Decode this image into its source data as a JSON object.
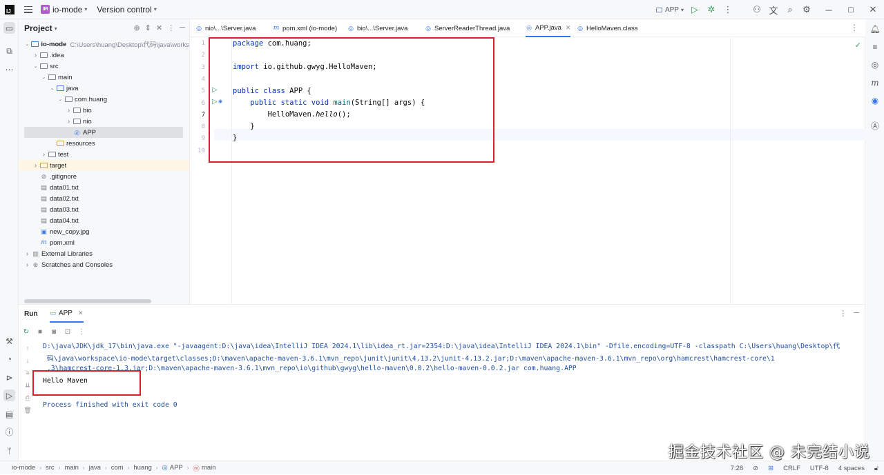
{
  "titlebar": {
    "project_badge": "IM",
    "project_name": "io-mode",
    "vcs_label": "Version control",
    "run_config": "APP"
  },
  "project_panel": {
    "title": "Project",
    "tree": [
      {
        "label": "io-mode",
        "hint": "C:\\Users\\huang\\Desktop\\代码\\java\\works",
        "depth": 0,
        "icon": "module-folder-icon",
        "expand": "open"
      },
      {
        "label": ".idea",
        "depth": 1,
        "icon": "folder-icon",
        "expand": "closed"
      },
      {
        "label": "src",
        "depth": 1,
        "icon": "folder-icon",
        "expand": "open"
      },
      {
        "label": "main",
        "depth": 2,
        "icon": "folder-icon",
        "expand": "open"
      },
      {
        "label": "java",
        "depth": 3,
        "icon": "source-folder-icon",
        "expand": "open"
      },
      {
        "label": "com.huang",
        "depth": 4,
        "icon": "package-icon",
        "expand": "open"
      },
      {
        "label": "bio",
        "depth": 5,
        "icon": "package-icon",
        "expand": "closed"
      },
      {
        "label": "nio",
        "depth": 5,
        "icon": "package-icon",
        "expand": "closed"
      },
      {
        "label": "APP",
        "depth": 5,
        "icon": "java-class-icon",
        "expand": "none",
        "selected": true
      },
      {
        "label": "resources",
        "depth": 3,
        "icon": "resources-folder-icon",
        "expand": "none"
      },
      {
        "label": "test",
        "depth": 2,
        "icon": "folder-icon",
        "expand": "closed"
      },
      {
        "label": "target",
        "depth": 1,
        "icon": "excluded-folder-icon",
        "expand": "closed",
        "highlight": true
      },
      {
        "label": ".gitignore",
        "depth": 1,
        "icon": "gitignore-icon",
        "expand": "none"
      },
      {
        "label": "data01.txt",
        "depth": 1,
        "icon": "text-file-icon",
        "expand": "none"
      },
      {
        "label": "data02.txt",
        "depth": 1,
        "icon": "text-file-icon",
        "expand": "none"
      },
      {
        "label": "data03.txt",
        "depth": 1,
        "icon": "text-file-icon",
        "expand": "none"
      },
      {
        "label": "data04.txt",
        "depth": 1,
        "icon": "text-file-icon",
        "expand": "none"
      },
      {
        "label": "new_copy.jpg",
        "depth": 1,
        "icon": "image-file-icon",
        "expand": "none"
      },
      {
        "label": "pom.xml",
        "depth": 1,
        "icon": "maven-icon",
        "expand": "none"
      },
      {
        "label": "External Libraries",
        "depth": 0,
        "icon": "libraries-icon",
        "expand": "closed"
      },
      {
        "label": "Scratches and Consoles",
        "depth": 0,
        "icon": "scratches-icon",
        "expand": "closed"
      }
    ]
  },
  "editor": {
    "tabs": [
      {
        "label": "nio\\...\\Server.java",
        "icon": "java-class-icon"
      },
      {
        "label": "pom.xml (io-mode)",
        "icon": "maven-icon"
      },
      {
        "label": "bio\\...\\Server.java",
        "icon": "java-class-icon"
      },
      {
        "label": "ServerReaderThread.java",
        "icon": "java-class-icon"
      },
      {
        "label": "APP.java",
        "icon": "java-class-icon",
        "active": true
      },
      {
        "label": "HelloMaven.class",
        "icon": "class-file-icon"
      }
    ],
    "line_numbers": [
      "1",
      "2",
      "3",
      "4",
      "5",
      "6",
      "7",
      "8",
      "9",
      "10"
    ],
    "code": {
      "l1_kw": "package",
      "l1_rest": " com.huang;",
      "l3_kw": "import",
      "l3_rest": " io.github.gwyg.HelloMaven;",
      "l5_kw": "public class",
      "l5_rest": " APP {",
      "l6_kw": "    public static void",
      "l6_m": " main",
      "l6_rest": "(String[] args) {",
      "l7_a": "        HelloMaven.",
      "l7_m": "hello",
      "l7_b": "();",
      "l8": "    }",
      "l9": "}"
    }
  },
  "run_panel": {
    "title": "Run",
    "tab_label": "APP",
    "console_lines": [
      "D:\\java\\JDK\\jdk_17\\bin\\java.exe \"-javaagent:D:\\java\\idea\\IntelliJ IDEA 2024.1\\lib\\idea_rt.jar=2354:D:\\java\\idea\\IntelliJ IDEA 2024.1\\bin\" -Dfile.encoding=UTF-8 -classpath C:\\Users\\huang\\Desktop\\代",
      " 码\\java\\workspace\\io-mode\\target\\classes;D:\\maven\\apache-maven-3.6.1\\mvn_repo\\junit\\junit\\4.13.2\\junit-4.13.2.jar;D:\\maven\\apache-maven-3.6.1\\mvn_repo\\org\\hamcrest\\hamcrest-core\\1",
      " .3\\hamcrest-core-1.3.jar;D:\\maven\\apache-maven-3.6.1\\mvn_repo\\io\\github\\gwyg\\hello-maven\\0.0.2\\hello-maven-0.0.2.jar com.huang.APP",
      "Hello Maven",
      "",
      "Process finished with exit code 0"
    ]
  },
  "statusbar": {
    "breadcrumbs": [
      "io-mode",
      "src",
      "main",
      "java",
      "com",
      "huang",
      "APP",
      "main"
    ],
    "position": "7:28",
    "line_sep": "CRLF",
    "encoding": "UTF-8",
    "indent": "4 spaces"
  },
  "watermark": "掘金技术社区 @ 未完结小说"
}
